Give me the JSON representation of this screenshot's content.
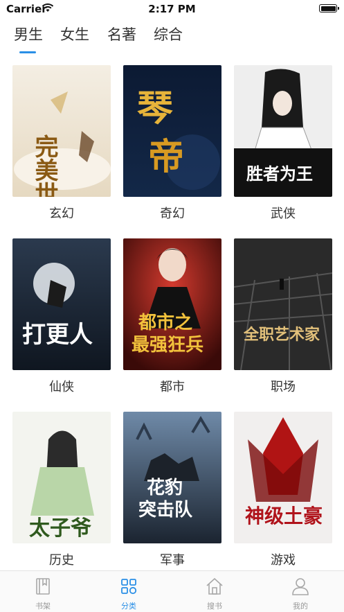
{
  "status_bar": {
    "carrier": "Carrier",
    "time": "2:17 PM"
  },
  "top_tabs": [
    {
      "label": "男生",
      "selected": true
    },
    {
      "label": "女生",
      "selected": false
    },
    {
      "label": "名著",
      "selected": false
    },
    {
      "label": "综合",
      "selected": false
    }
  ],
  "accent_color": "#2a8fe6",
  "categories": [
    {
      "label": "玄幻",
      "cover_title": "完美世界"
    },
    {
      "label": "奇幻",
      "cover_title": "琴帝"
    },
    {
      "label": "武侠",
      "cover_title": "胜者为王"
    },
    {
      "label": "仙侠",
      "cover_title": "打更人"
    },
    {
      "label": "都市",
      "cover_title": "都市之最强狂兵"
    },
    {
      "label": "职场",
      "cover_title": "全职艺术家"
    },
    {
      "label": "历史",
      "cover_title": "太子爷"
    },
    {
      "label": "军事",
      "cover_title": "花豹突击队"
    },
    {
      "label": "游戏",
      "cover_title": "神级土豪"
    }
  ],
  "bottom_tabs": [
    {
      "label": "书架",
      "icon": "bookshelf-icon",
      "active": false
    },
    {
      "label": "分类",
      "icon": "category-grid-icon",
      "active": true
    },
    {
      "label": "搜书",
      "icon": "home-search-icon",
      "active": false
    },
    {
      "label": "我的",
      "icon": "user-profile-icon",
      "active": false
    }
  ]
}
